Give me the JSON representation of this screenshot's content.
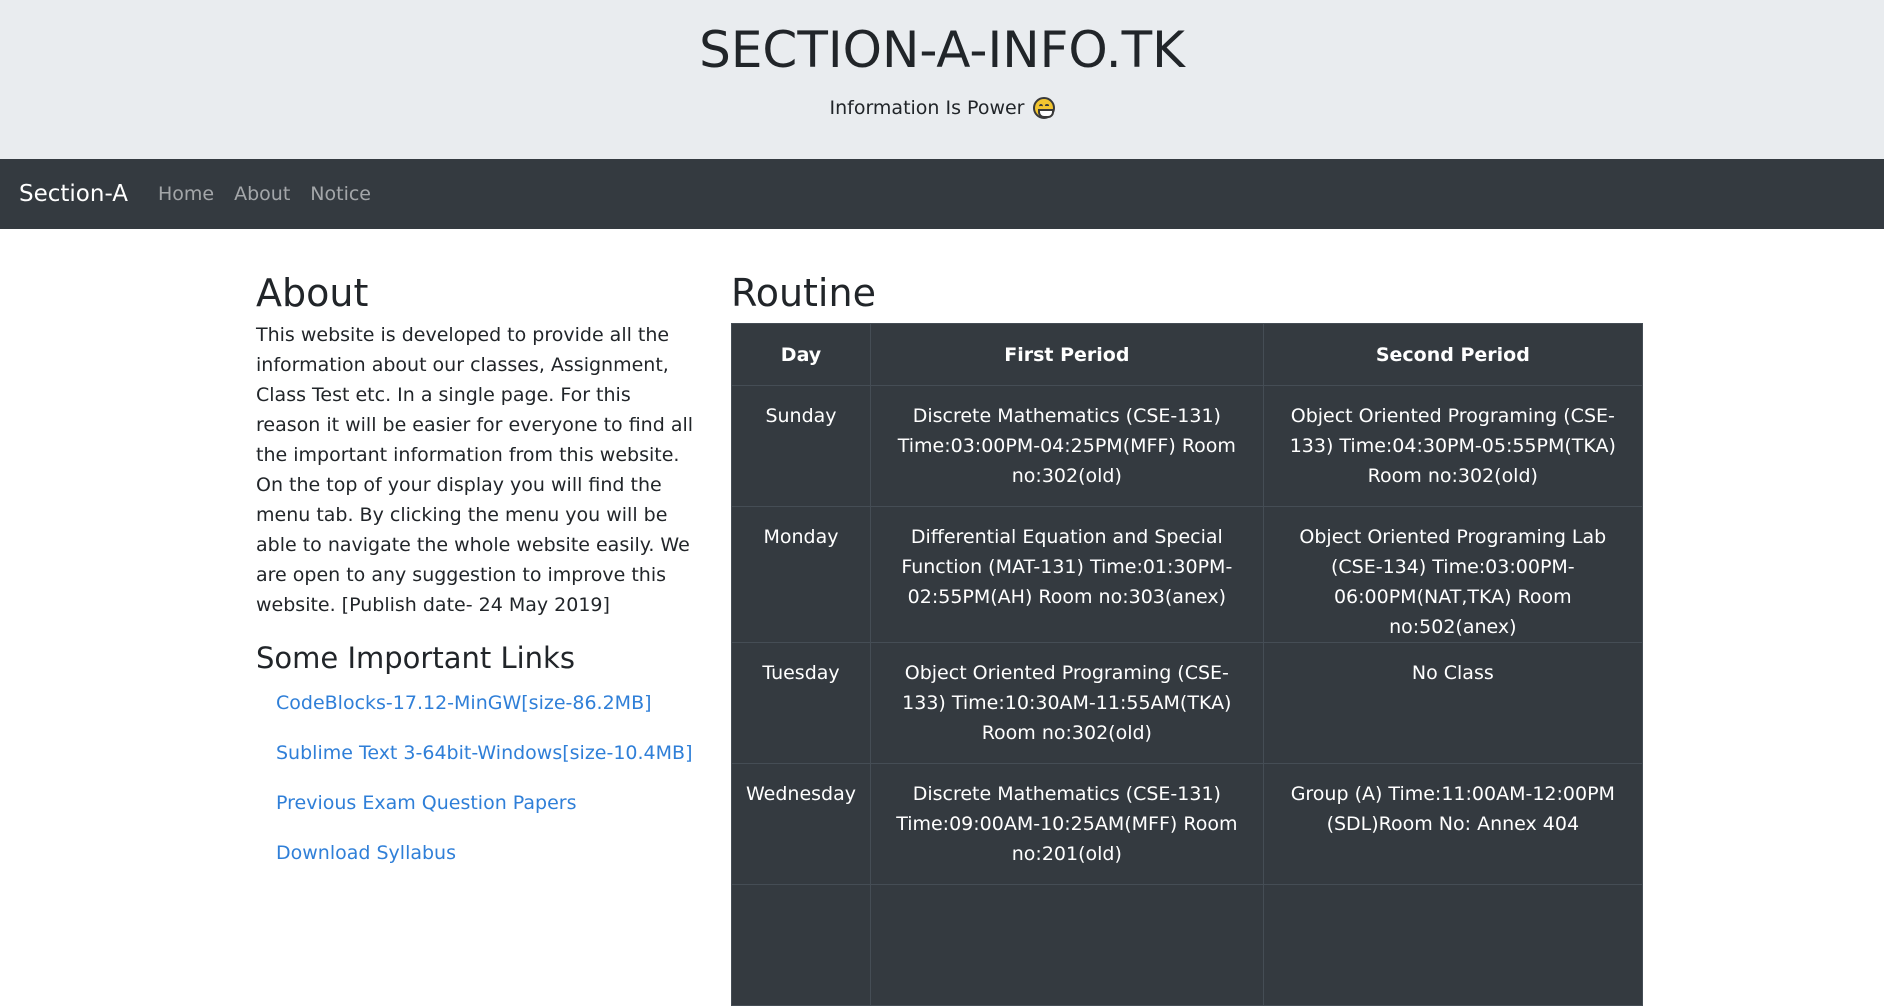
{
  "header": {
    "site_title": "SECTION-A-INFO.TK",
    "tagline": "Information Is Power",
    "tagline_emoji": "grinning-face-icon"
  },
  "navbar": {
    "brand": "Section-A",
    "links": [
      "Home",
      "About",
      "Notice"
    ]
  },
  "about": {
    "heading": "About",
    "text": "This website is developed to provide all the information about our classes, Assignment, Class Test etc. In a single page. For this reason it will be easier for everyone to find all the important information from this website. On the top of your display you will find the menu tab. By clicking the menu you will be able to navigate the whole website easily. We are open to any suggestion to improve this website. [Publish date- 24 May 2019]",
    "links_heading": "Some Important Links",
    "links": [
      "CodeBlocks-17.12-MinGW[size-86.2MB]",
      "Sublime Text 3-64bit-Windows[size-10.4MB]",
      "Previous Exam Question Papers",
      "Download Syllabus"
    ]
  },
  "routine": {
    "heading": "Routine",
    "columns": [
      "Day",
      "First Period",
      "Second Period"
    ],
    "rows": [
      {
        "day": "Sunday",
        "first": "Discrete Mathematics (CSE-131) Time:03:00PM-04:25PM(MFF) Room no:302(old)",
        "second": "Object Oriented Programing (CSE-133) Time:04:30PM-05:55PM(TKA) Room no:302(old)"
      },
      {
        "day": "Monday",
        "first": "Differential Equation and Special Function (MAT-131) Time:01:30PM-02:55PM(AH) Room no:303(anex)",
        "second": "Object Oriented Programing Lab (CSE-134) Time:03:00PM-06:00PM(NAT,TKA) Room no:502(anex)"
      },
      {
        "day": "Tuesday",
        "first": "Object Oriented Programing (CSE-133) Time:10:30AM-11:55AM(TKA) Room no:302(old)",
        "second": "No Class"
      },
      {
        "day": "Wednesday",
        "first": "Discrete Mathematics (CSE-131) Time:09:00AM-10:25AM(MFF) Room no:201(old)",
        "second": "Group (A) Time:11:00AM-12:00PM (SDL)Room No: Annex 404"
      }
    ]
  }
}
